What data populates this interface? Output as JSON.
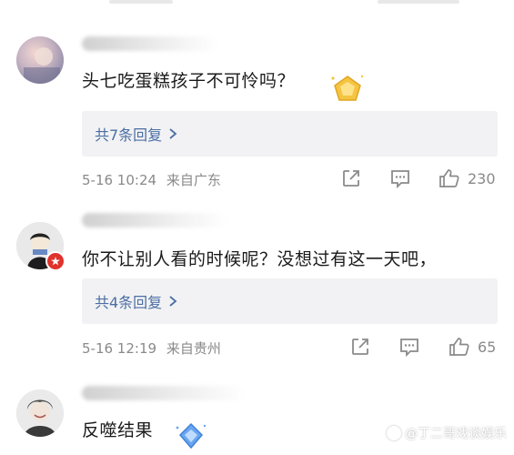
{
  "comments": [
    {
      "text": "头七吃蛋糕孩子不可怜吗？",
      "replies_label": "共7条回复",
      "date": "5-16 10:24",
      "location": "来自广东",
      "likes": "230"
    },
    {
      "text": "你不让别人看的时候呢？没想过有这一天吧，",
      "replies_label": "共4条回复",
      "date": "5-16 12:19",
      "location": "来自贵州",
      "likes": "65"
    },
    {
      "text": "反噬结果"
    }
  ],
  "watermark": "@丁二哥戏谈娱乐",
  "colors": {
    "link_blue": "#4b6fa3",
    "meta_gray": "#8a8a8a",
    "reply_bg": "#f2f2f4",
    "badge_red": "#e0322b",
    "gem_gold": "#f5c542",
    "gem_blue": "#6aa6f0"
  },
  "icons": [
    "chevron-right-icon",
    "share-icon",
    "comment-icon",
    "like-icon",
    "gold-gem-badge-icon",
    "blue-gem-badge-icon",
    "watermark-logo-icon"
  ]
}
